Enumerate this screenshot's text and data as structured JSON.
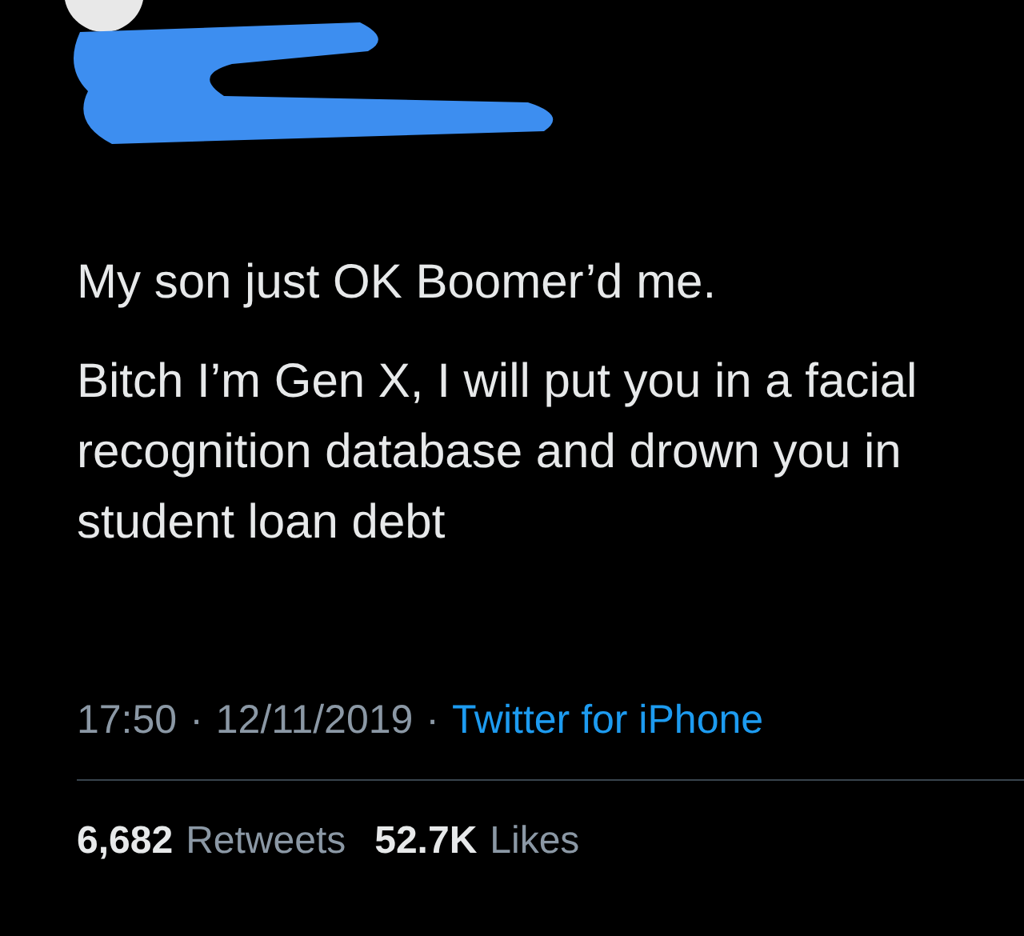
{
  "tweet": {
    "paragraphs": [
      "My son just OK Boomer’d me.",
      "Bitch I’m Gen X, I will put you in a facial recognition database and drown you in student loan debt"
    ],
    "meta": {
      "time": "17:50",
      "separator": "·",
      "date": "12/11/2019",
      "source": "Twitter for iPhone"
    },
    "stats": [
      {
        "count": "6,682",
        "label": "Retweets"
      },
      {
        "count": "52.7K",
        "label": "Likes"
      }
    ]
  }
}
